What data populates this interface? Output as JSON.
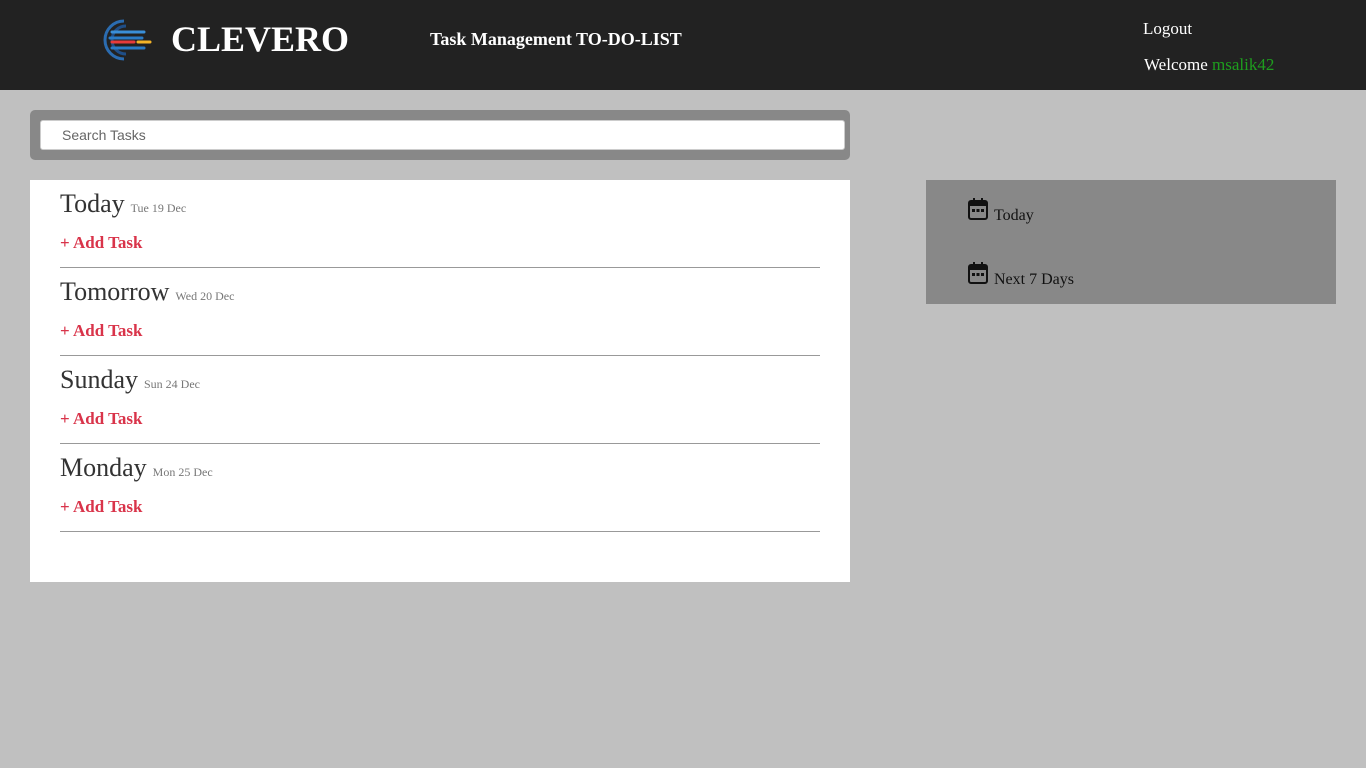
{
  "header": {
    "brand": "CLEVERO",
    "app_title": "Task Management TO-DO-LIST",
    "logout_label": "Logout",
    "welcome_label": "Welcome",
    "username": "msalik42",
    "logo_icon": "clevero-logo-icon"
  },
  "search": {
    "placeholder": "Search Tasks",
    "value": ""
  },
  "days": [
    {
      "name": "Today",
      "date": "Tue 19 Dec",
      "add_label": "+ Add Task"
    },
    {
      "name": "Tomorrow",
      "date": "Wed 20 Dec",
      "add_label": "+ Add Task"
    },
    {
      "name": "Sunday",
      "date": "Sun 24 Dec",
      "add_label": "+ Add Task"
    },
    {
      "name": "Monday",
      "date": "Mon 25 Dec",
      "add_label": "+ Add Task"
    }
  ],
  "sidebar": {
    "items": [
      {
        "label": "Today",
        "icon": "calendar-icon"
      },
      {
        "label": "Next 7 Days",
        "icon": "calendar-icon"
      }
    ]
  },
  "colors": {
    "header_bg": "#222222",
    "page_bg": "#c0c0c0",
    "accent_add_task": "#d9344a",
    "username": "#1e9e1e",
    "sidebar_bg": "#888888"
  }
}
